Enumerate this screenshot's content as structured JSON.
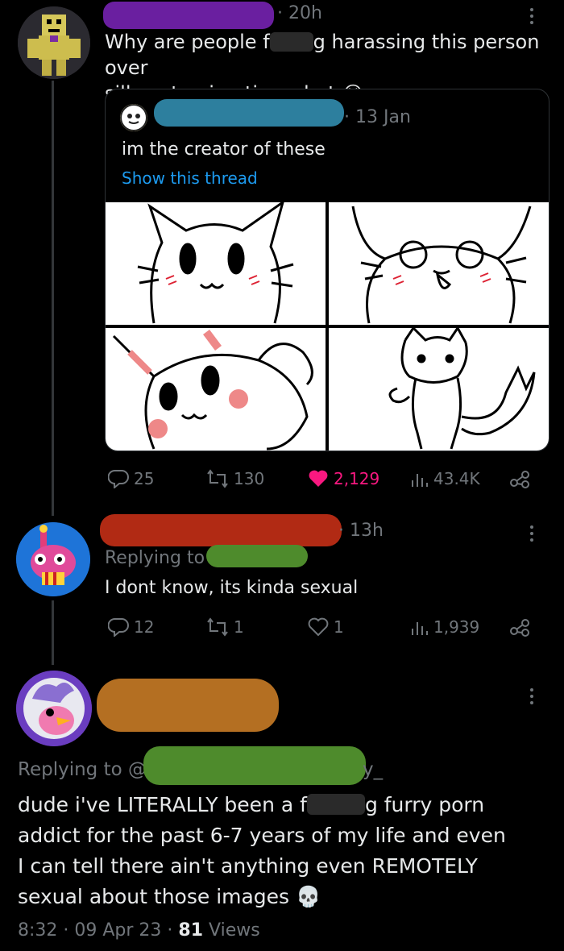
{
  "tweet1": {
    "time": "· 20h",
    "text_line1": "Why are people f",
    "text_line1_b": "g harassing this person over",
    "text_line2": "silly cat animation what",
    "emoji": "😭"
  },
  "quote": {
    "time": "· 13 Jan",
    "text": "im the creator of these",
    "show_thread": "Show this thread"
  },
  "tweet1_actions": {
    "replies": "25",
    "retweets": "130",
    "likes": "2,129",
    "views": "43.4K"
  },
  "tweet2": {
    "time": "· 13h",
    "replying_to": "Replying to",
    "text": "I dont know, its kinda sexual"
  },
  "tweet2_actions": {
    "replies": "12",
    "retweets": "1",
    "likes": "1",
    "views": "1,939"
  },
  "tweet3": {
    "replying_to": "Replying to @",
    "handle_tail": "y_",
    "line1_a": "dude i've LITERALLY been a f",
    "line1_b": "g furry porn",
    "line2": "addict for the past 6-7 years of my life and even",
    "line3": "I can tell there ain't anything even REMOTELY",
    "line4": "sexual about those images",
    "emoji": "💀",
    "time": "8:32 · 09 Apr 23 · ",
    "views_count": "81",
    "views_label": " Views"
  },
  "colors": {
    "bg": "#000000",
    "text": "#e7e9ea",
    "muted": "#71767b",
    "link": "#1d9bf0",
    "like": "#f91880",
    "redact_purple": "#6a1fa0",
    "redact_teal": "#2d7f9e",
    "redact_red": "#b12a14",
    "redact_green": "#4e8b2c",
    "redact_orange": "#b46f22"
  },
  "icons": [
    "reply-icon",
    "retweet-icon",
    "like-icon",
    "views-icon",
    "share-icon",
    "more-icon",
    "skull-emoji",
    "crying-emoji"
  ]
}
